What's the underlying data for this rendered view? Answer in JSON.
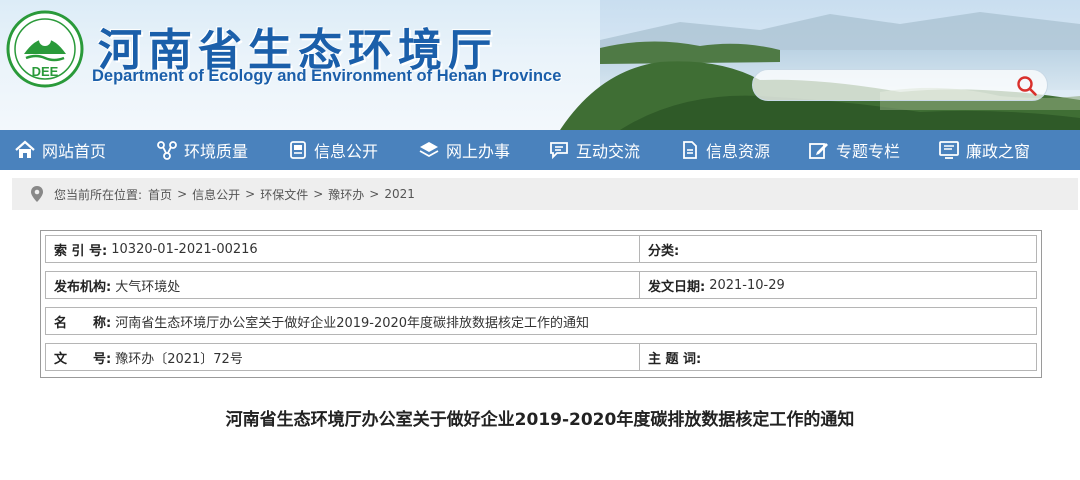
{
  "header": {
    "logo_text": "DEE",
    "title": "河南省生态环境厅",
    "subtitle": "Department of Ecology and Environment of Henan Province",
    "search": {
      "value": "",
      "placeholder": ""
    }
  },
  "nav": {
    "items": [
      {
        "label": "网站首页",
        "icon": "home-icon"
      },
      {
        "label": "环境质量",
        "icon": "molecule-icon"
      },
      {
        "label": "信息公开",
        "icon": "document-icon"
      },
      {
        "label": "网上办事",
        "icon": "layers-icon"
      },
      {
        "label": "互动交流",
        "icon": "chat-icon"
      },
      {
        "label": "信息资源",
        "icon": "file-icon"
      },
      {
        "label": "专题专栏",
        "icon": "edit-icon"
      },
      {
        "label": "廉政之窗",
        "icon": "monitor-icon"
      }
    ]
  },
  "breadcrumb": {
    "prefix": "您当前所在位置:",
    "items": [
      "首页",
      "信息公开",
      "环保文件",
      "豫环办",
      "2021"
    ],
    "separator": ">"
  },
  "meta": {
    "index_no": {
      "key": "索 引 号:",
      "value": "10320-01-2021-00216"
    },
    "category": {
      "key": "分类:",
      "value": ""
    },
    "publisher": {
      "key": "发布机构:",
      "value": "大气环境处"
    },
    "date": {
      "key": "发文日期:",
      "value": "2021-10-29"
    },
    "name": {
      "key": "名　　称:",
      "value": "河南省生态环境厅办公室关于做好企业2019-2020年度碳排放数据核定工作的通知"
    },
    "doc_no": {
      "key": "文　　号:",
      "value": "豫环办〔2021〕72号"
    },
    "keywords": {
      "key": "主 题 词:",
      "value": ""
    }
  },
  "article": {
    "title": "河南省生态环境厅办公室关于做好企业2019-2020年度碳排放数据核定工作的通知"
  },
  "colors": {
    "nav_bg": "#4a82bd",
    "title_blue": "#1b5faa",
    "logo_green": "#2a9a3a",
    "search_icon": "#d9302c"
  }
}
